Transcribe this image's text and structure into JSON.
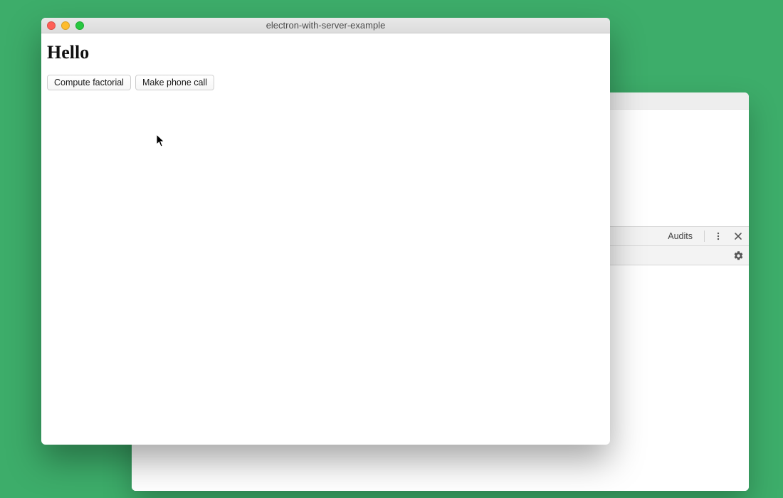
{
  "desktop": {
    "background_color": "#3dad6a"
  },
  "bg_window": {
    "devtools": {
      "visible_tab_label": "Audits"
    }
  },
  "main_window": {
    "title": "electron-with-server-example",
    "heading": "Hello",
    "buttons": {
      "compute_factorial": "Compute factorial",
      "make_phone_call": "Make phone call"
    }
  }
}
